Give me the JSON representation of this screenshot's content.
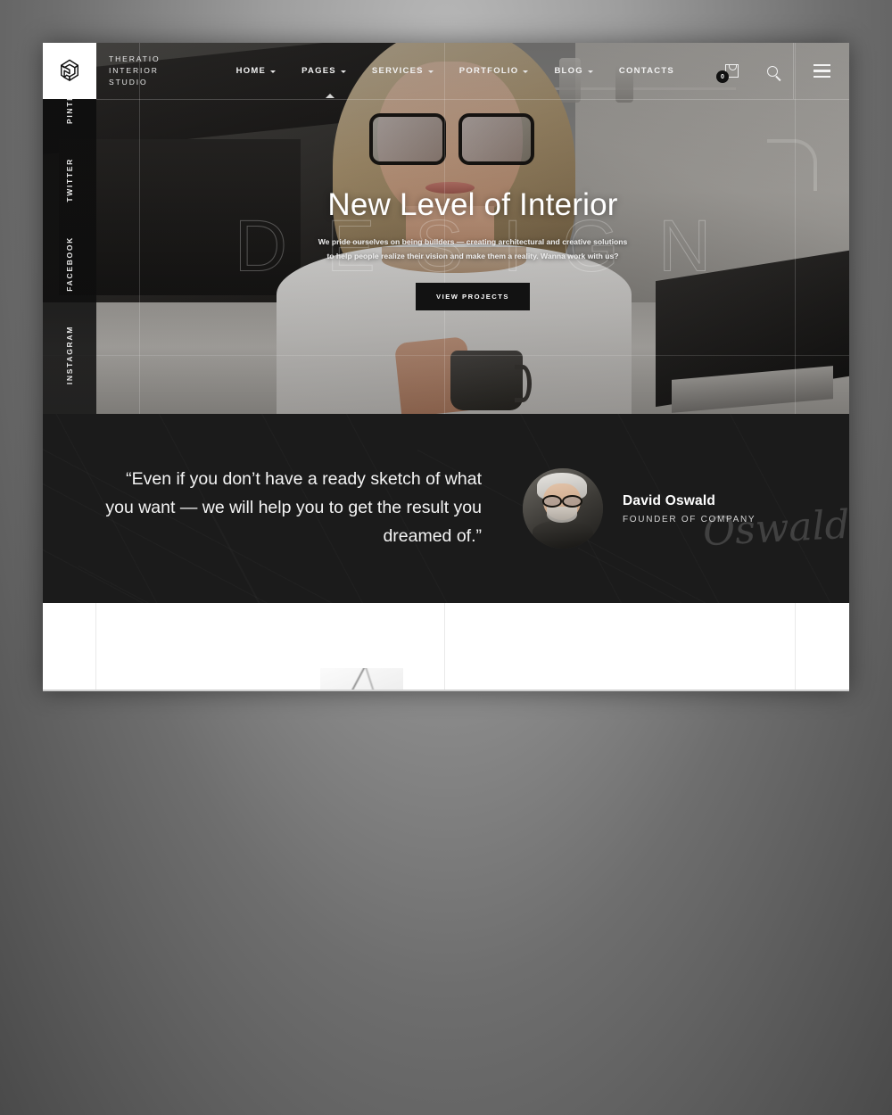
{
  "header": {
    "logo_icon": "interlocking-triangle-logo",
    "brand_lines": [
      "THERATIO",
      "INTERIOR",
      "STUDIO"
    ],
    "nav": [
      {
        "label": "HOME",
        "has_dropdown": true,
        "active": true
      },
      {
        "label": "PAGES",
        "has_dropdown": true,
        "active": false
      },
      {
        "label": "SERVICES",
        "has_dropdown": true,
        "active": false
      },
      {
        "label": "PORTFOLIO",
        "has_dropdown": true,
        "active": false
      },
      {
        "label": "BLOG",
        "has_dropdown": true,
        "active": false
      },
      {
        "label": "CONTACTS",
        "has_dropdown": false,
        "active": false
      }
    ],
    "cart": {
      "icon": "shopping-bag-icon",
      "count": "0"
    },
    "search_icon": "search-icon",
    "menu_icon": "hamburger-menu-icon"
  },
  "social": {
    "items": [
      {
        "label": "INSTAGRAM"
      },
      {
        "label": "FACEBOOK"
      },
      {
        "label": "TWITTER"
      },
      {
        "label": "PINTEREST"
      }
    ]
  },
  "hero": {
    "watermark": "DESIGN",
    "title": "New Level of Interior",
    "subtitle": "We pride ourselves on being builders — creating architectural and creative solutions to help people realize their vision and make them a reality. Wanna work with us?",
    "cta_label": "VIEW PROJECTS",
    "prev_icon": "arrow-left-icon",
    "next_icon": "arrow-right-icon"
  },
  "testimonial": {
    "quote": "“Even if you don’t have a ready sketch of what you want — we will help you to get the result you dreamed of.”",
    "author_name": "David Oswald",
    "author_role": "FOUNDER OF COMPANY",
    "signature": "Oswald",
    "avatar_alt": "author-portrait"
  },
  "colors": {
    "dark": "#1b1b1b",
    "accent_text": "#ffffff",
    "button_bg": "#121212",
    "white_section": "#ffffff"
  }
}
